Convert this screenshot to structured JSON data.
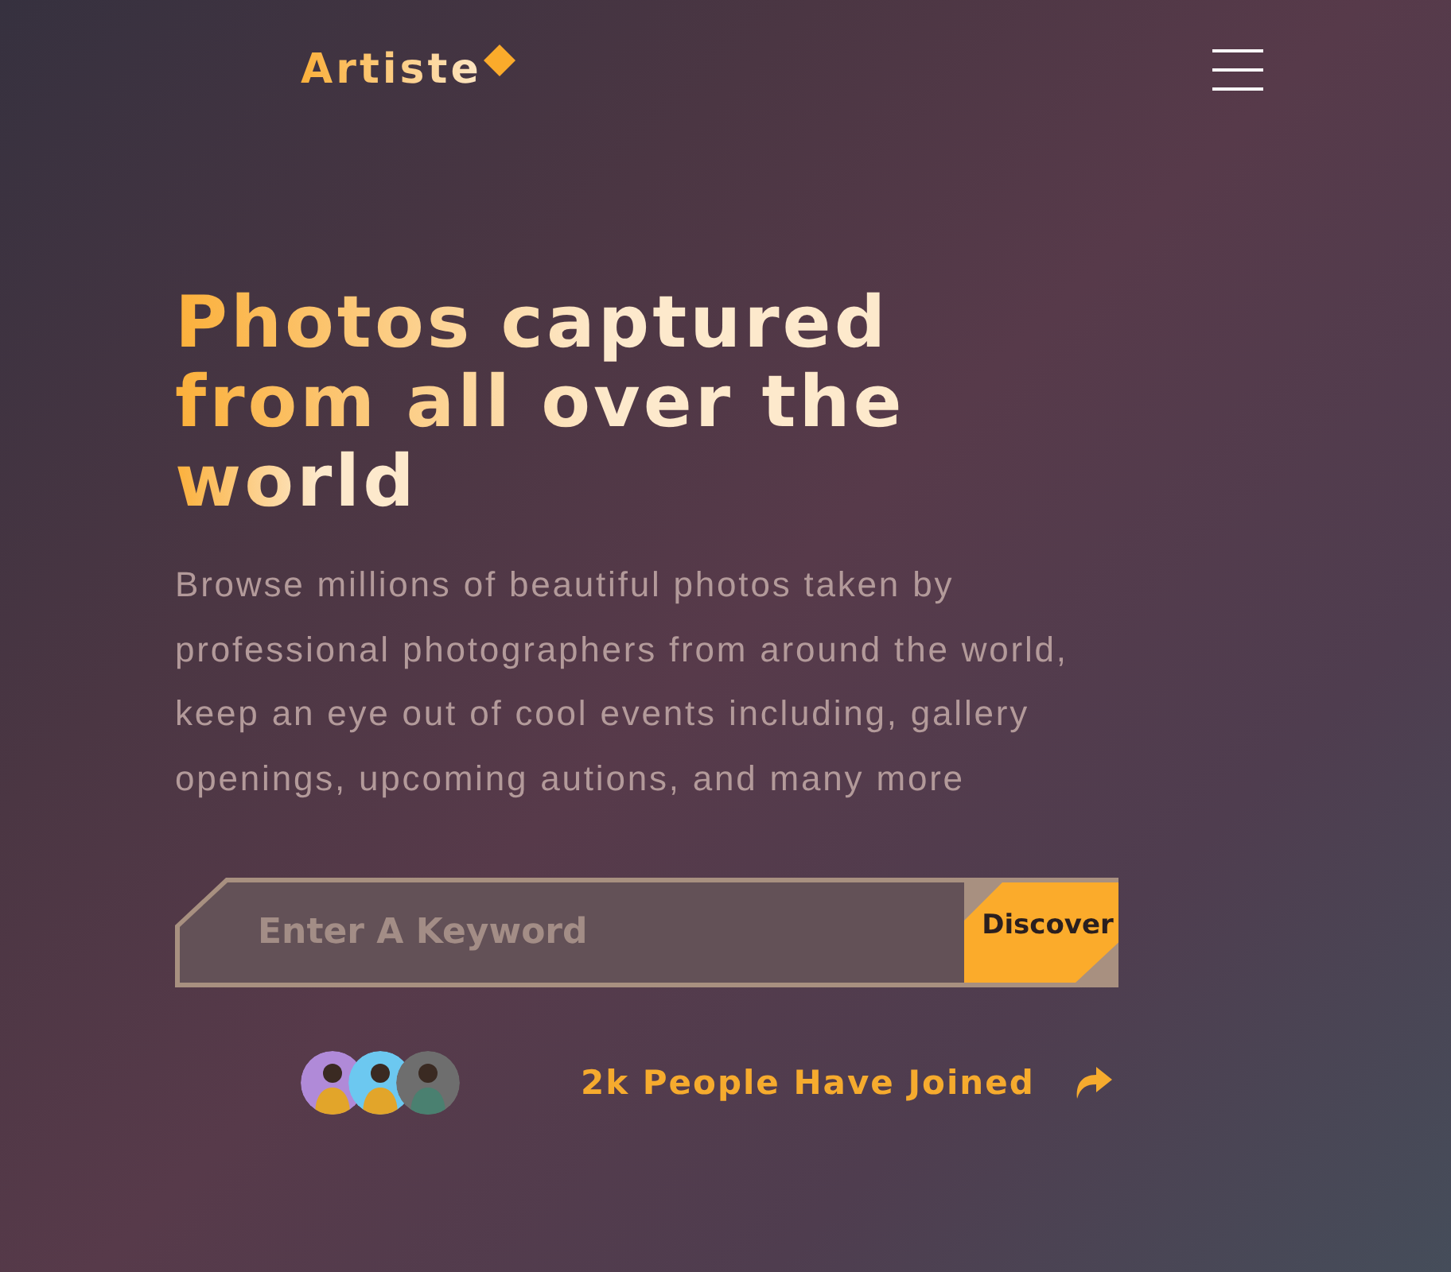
{
  "header": {
    "logo": "Artiste"
  },
  "hero": {
    "heading_lines": [
      "Photos captured",
      "from all over the",
      "world"
    ],
    "description": "Browse millions of beautiful photos taken by professional photographers from around the world, keep an eye out of cool events including, gallery openings, upcoming autions, and many more"
  },
  "search": {
    "placeholder": "Enter A Keyword",
    "button": "Discover"
  },
  "joined": {
    "avatars": [
      {
        "color": "#b08ad8"
      },
      {
        "color": "#6cc8f0"
      },
      {
        "color": "#6e6e6e"
      }
    ],
    "text": "2k People Have Joined"
  }
}
